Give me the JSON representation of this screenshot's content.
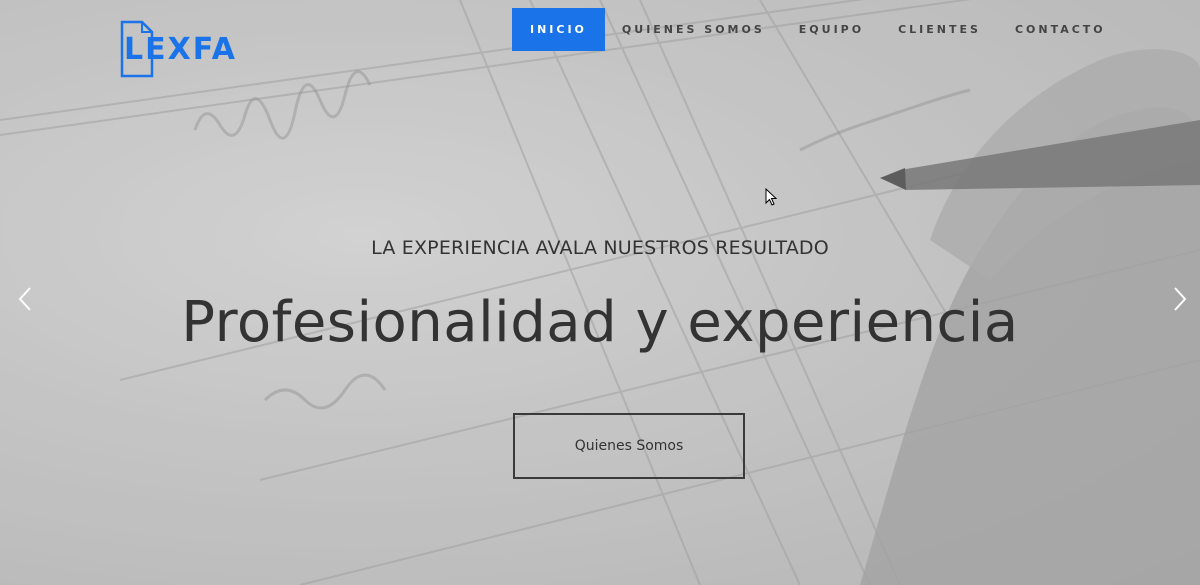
{
  "logo": {
    "text": "LEXFA",
    "icon": "document-icon",
    "color": "#1a73e8"
  },
  "nav": {
    "items": [
      {
        "label": "INICIO",
        "active": true
      },
      {
        "label": "QUIENES SOMOS",
        "active": false
      },
      {
        "label": "EQUIPO",
        "active": false
      },
      {
        "label": "CLIENTES",
        "active": false
      },
      {
        "label": "CONTACTO",
        "active": false
      }
    ],
    "active_color": "#1a73e8"
  },
  "hero": {
    "subtitle": "LA EXPERIENCIA AVALA NUESTROS RESULTADO",
    "headline": "Profesionalidad y experiencia",
    "cta_label": "Quienes Somos",
    "prev_icon": "chevron-left-icon",
    "next_icon": "chevron-right-icon"
  }
}
